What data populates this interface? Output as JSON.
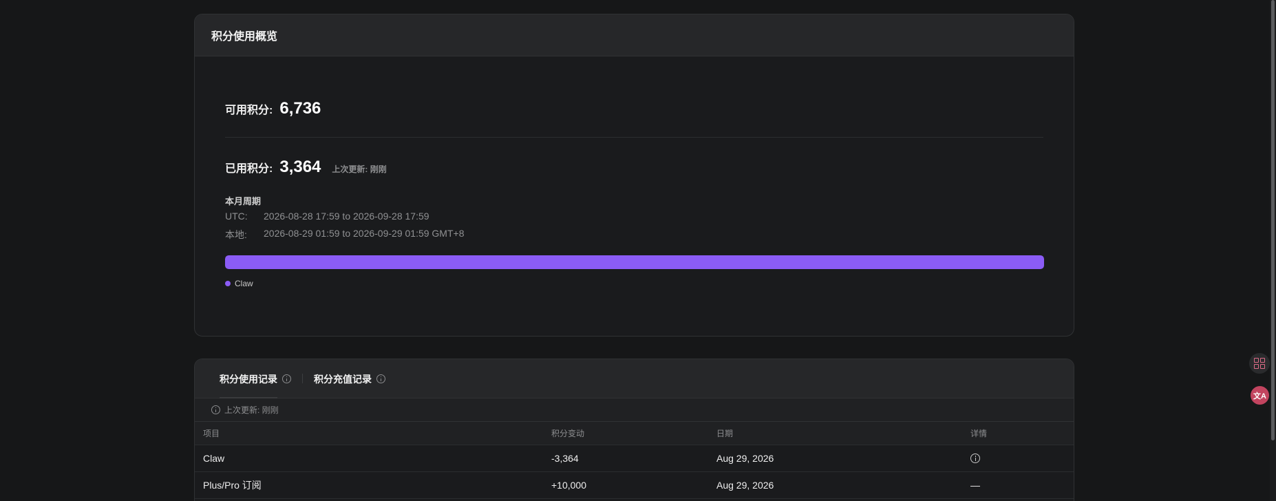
{
  "overview": {
    "title": "积分使用概览",
    "available_label": "可用积分:",
    "available_value": "6,736",
    "used_label": "已用积分:",
    "used_value": "3,364",
    "updated_text": "上次更新: 刚刚",
    "cycle": {
      "title": "本月周期",
      "utc_label": "UTC:",
      "utc_range": "2026-08-28 17:59 to 2026-09-28 17:59",
      "local_label": "本地:",
      "local_range": "2026-08-29 01:59 to 2026-09-29 01:59 GMT+8"
    },
    "usage_bar": {
      "fill_fraction": 1.0,
      "color": "#8b5cf6"
    },
    "legend": [
      {
        "label": "Claw",
        "color": "#8b5cf6"
      }
    ]
  },
  "records": {
    "tabs": [
      {
        "label": "积分使用记录",
        "active": true
      },
      {
        "label": "积分充值记录",
        "active": false
      }
    ],
    "updated_text": "上次更新: 刚刚",
    "columns": [
      "项目",
      "积分变动",
      "日期",
      "详情"
    ],
    "rows": [
      {
        "item": "Claw",
        "change": "-3,364",
        "date": "Aug 29, 2026",
        "detail": "info-icon"
      },
      {
        "item": "Plus/Pro 订阅",
        "change": "+10,000",
        "date": "Aug 29, 2026",
        "detail": "—"
      }
    ]
  },
  "floating": {
    "apps_icon": "apps-grid-icon",
    "translate_icon": "translate-icon",
    "translate_glyph": "文A"
  }
}
